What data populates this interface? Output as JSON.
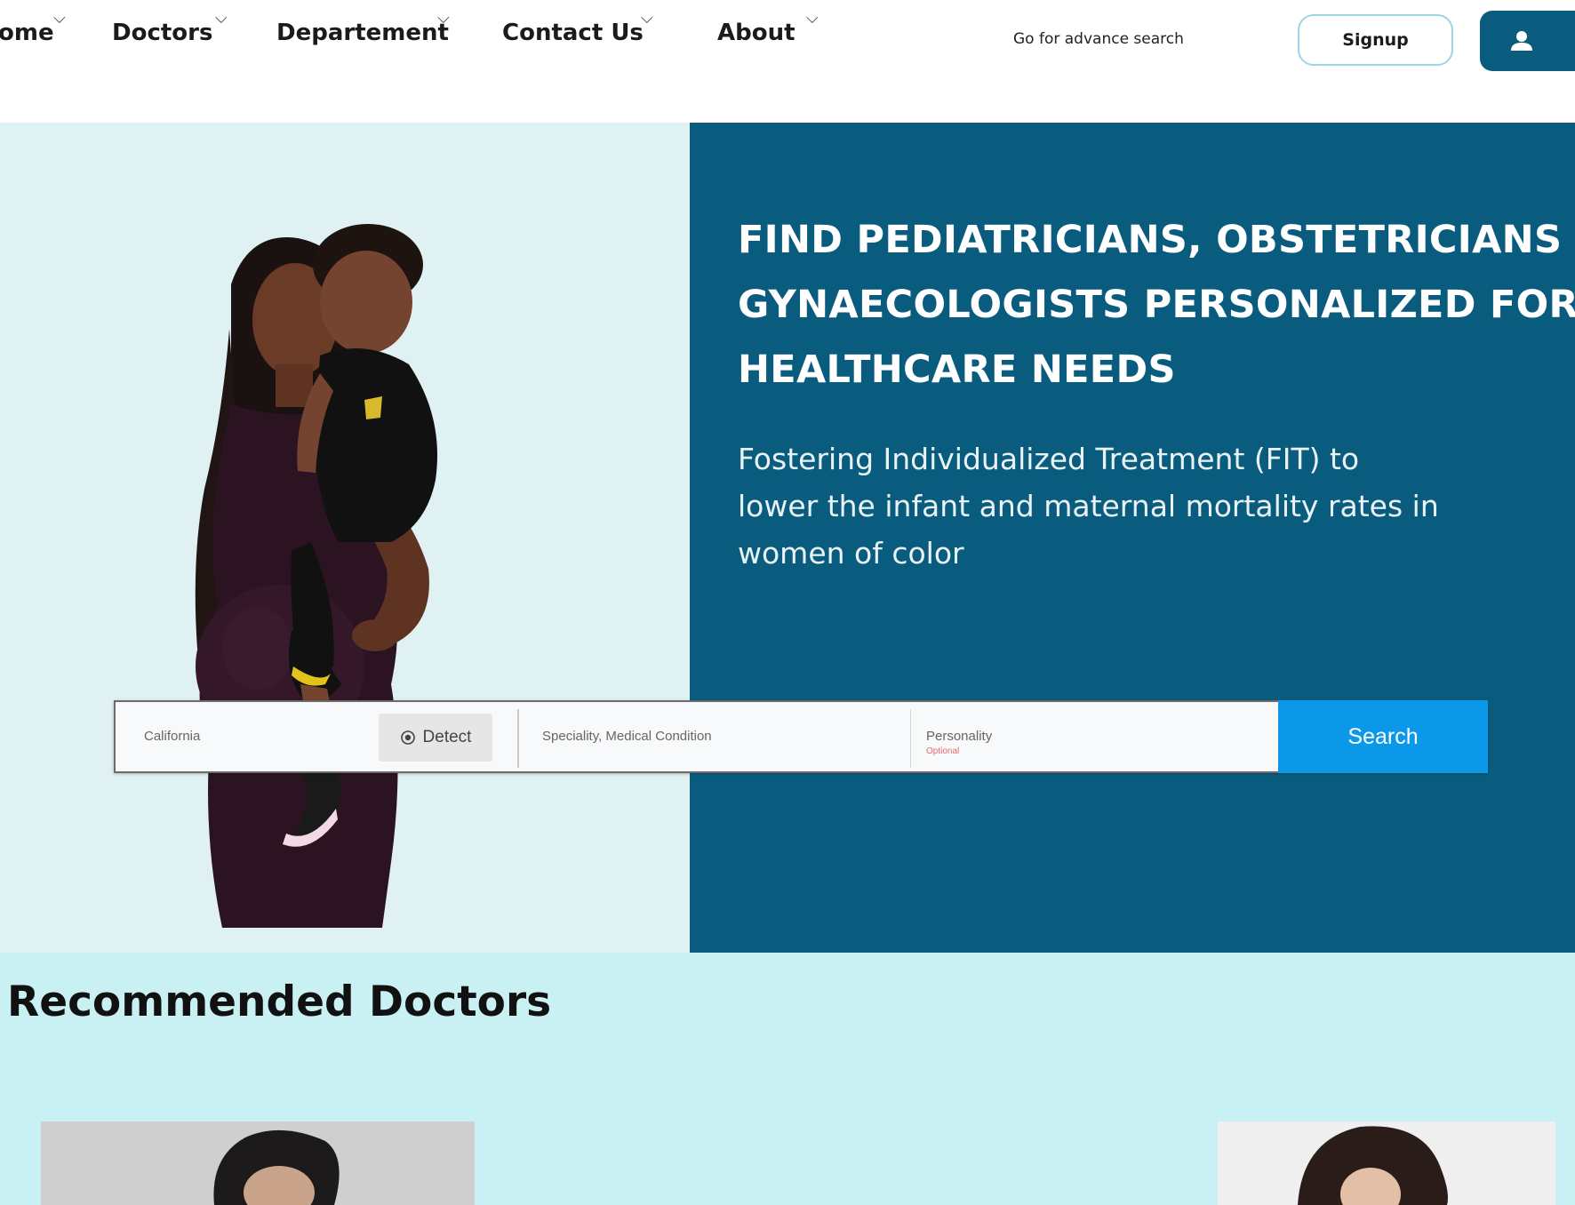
{
  "nav": {
    "items": [
      {
        "label": "ome"
      },
      {
        "label": "Doctors"
      },
      {
        "label": "Departement"
      },
      {
        "label": "Contact Us"
      },
      {
        "label": "About"
      }
    ],
    "advance_search": "Go for advance search",
    "signup": "Signup",
    "login_icon": "user-icon",
    "dropdown_icon": "chevron-down-icon"
  },
  "hero": {
    "title_lines": [
      "FIND PEDIATRICIANS, OBSTETRICIANS A",
      "GYNAECOLOGISTS PERSONALIZED FOR",
      "HEALTHCARE NEEDS"
    ],
    "subtitle_lines": [
      "Fostering Individualized Treatment (FIT) to",
      "lower the infant and maternal mortality rates in",
      "women of color"
    ]
  },
  "search": {
    "location_placeholder": "California",
    "detect_label": "Detect",
    "detect_icon": "location-target-icon",
    "specialty_placeholder": "Speciality, Medical Condition",
    "personality_placeholder": "Personality",
    "personality_note": "Optional",
    "search_label": "Search"
  },
  "recommended": {
    "title": "Recommended Doctors"
  },
  "colors": {
    "brand_dark": "#0a5c7f",
    "hero_left_bg": "#dff1f3",
    "search_button": "#0c98e8",
    "recommended_bg": "#c9f1f4",
    "optional_text": "#e46b6b"
  }
}
